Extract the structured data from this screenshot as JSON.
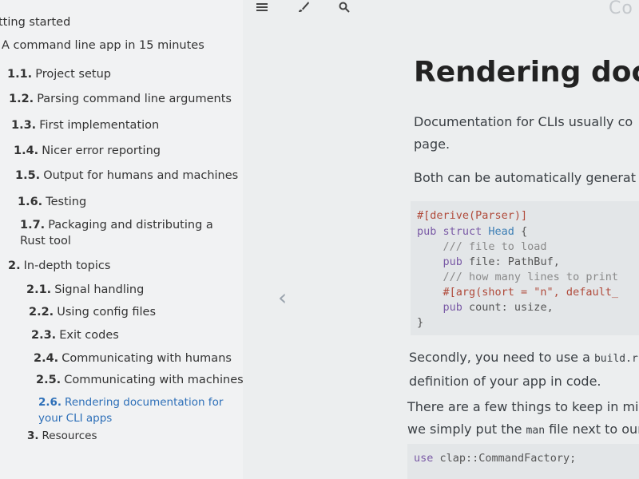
{
  "sidebar": {
    "items": [
      {
        "num": "",
        "label": "tting started"
      },
      {
        "num": "",
        "label": "A command line app in 15 minutes"
      },
      {
        "num": "1.1.",
        "label": "Project setup"
      },
      {
        "num": "1.2.",
        "label": "Parsing command line arguments"
      },
      {
        "num": "1.3.",
        "label": "First implementation"
      },
      {
        "num": "1.4.",
        "label": "Nicer error reporting"
      },
      {
        "num": "1.5.",
        "label": "Output for humans and machines"
      },
      {
        "num": "1.6.",
        "label": "Testing"
      },
      {
        "num": "1.7.",
        "label": "Packaging and distributing a Rust tool"
      },
      {
        "num": "2.",
        "label": "In-depth topics"
      },
      {
        "num": "2.1.",
        "label": "Signal handling"
      },
      {
        "num": "2.2.",
        "label": "Using config files"
      },
      {
        "num": "2.3.",
        "label": "Exit codes"
      },
      {
        "num": "2.4.",
        "label": "Communicating with humans"
      },
      {
        "num": "2.5.",
        "label": "Communicating with machines"
      },
      {
        "num": "2.6.",
        "label": "Rendering documentation for your CLI apps"
      },
      {
        "num": "3.",
        "label": "Resources"
      }
    ],
    "active_index": 15
  },
  "toolbar": {
    "menu_icon": "hamburger-icon",
    "theme_icon": "paintbrush-icon",
    "search_icon": "search-icon",
    "book_title": "Co"
  },
  "content": {
    "title": "Rendering docu",
    "para1_line1": "Documentation for CLIs usually co",
    "para1_line2": "page.",
    "para2": "Both can be automatically generat",
    "code": {
      "l1": "#[derive(Parser)]",
      "l2_kw": "pub struct",
      "l2_ty": "Head",
      "l2_rest": " {",
      "l3": "    /// file to load",
      "l4_kw": "    pub",
      "l4_rest": " file: PathBuf,",
      "l5": "    /// how many lines to print",
      "l6_attr": "    #[arg(short = \"n\", default_",
      "l7_kw": "    pub",
      "l7_rest": " count: usize,",
      "l8": "}"
    },
    "para3_line1_a": "Secondly, you need to use a",
    "para3_line1_code": "build.r",
    "para3_line2": "definition of your app in code.",
    "para4_line1": "There are a few things to keep in minc",
    "para4_line2_a": "we simply put the",
    "para4_line2_code": "man",
    "para4_line2_b": "file next to our",
    "code2_kw": "use",
    "code2_rest": " clap::CommandFactory;"
  },
  "nav": {
    "prev_icon": "chevron-left-icon",
    "prev_glyph": "‹"
  }
}
